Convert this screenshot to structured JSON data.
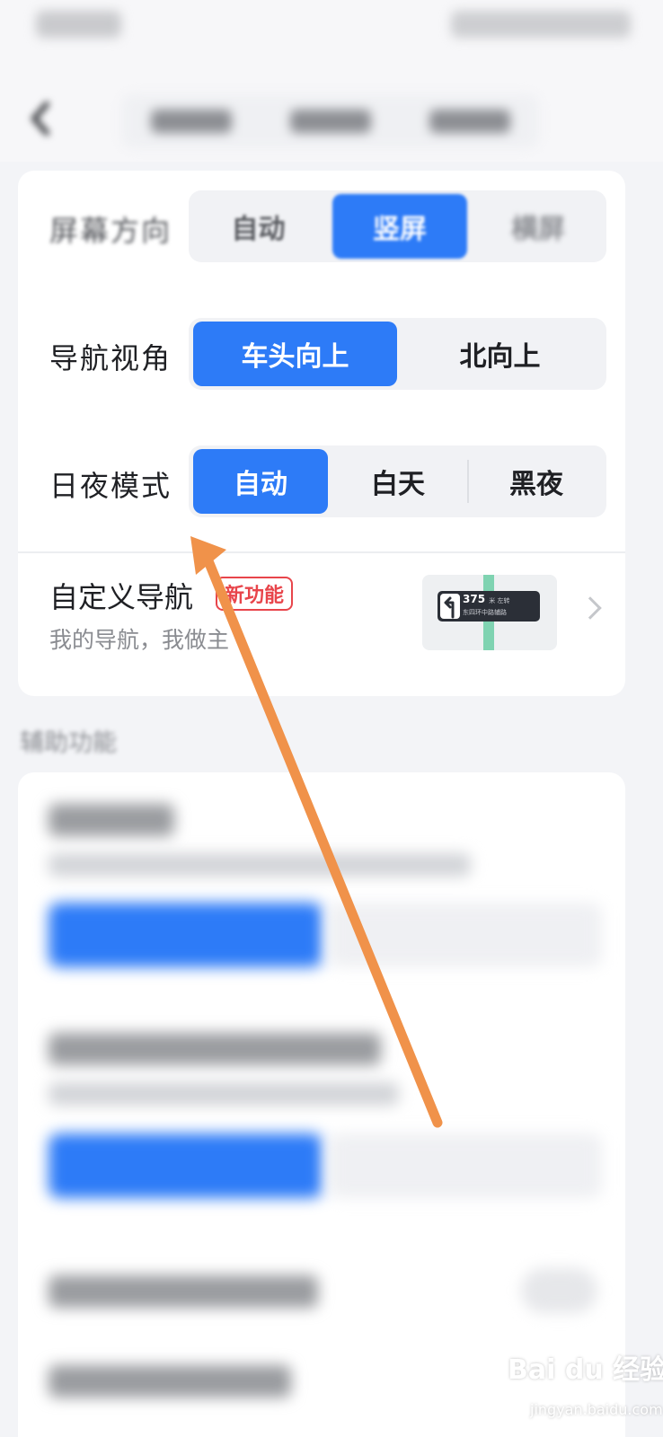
{
  "settings": {
    "screen_orientation": {
      "label": "屏幕方向",
      "options": [
        "自动",
        "竖屏",
        "横屏"
      ],
      "selected": "竖屏"
    },
    "nav_view": {
      "label": "导航视角",
      "options": [
        "车头向上",
        "北向上"
      ],
      "selected": "车头向上"
    },
    "day_night": {
      "label": "日夜模式",
      "options": [
        "自动",
        "白天",
        "黑夜"
      ],
      "selected": "自动"
    },
    "custom_nav": {
      "title": "自定义导航",
      "badge": "新功能",
      "subtitle": "我的导航，我做主",
      "preview_distance": "375",
      "preview_unit": "米 左转",
      "preview_road": "东四环中路辅路"
    }
  },
  "section": {
    "title": "辅助功能"
  },
  "watermark": {
    "main": "Bai du 经验",
    "sub": "jingyan.baidu.com"
  },
  "colors": {
    "accent": "#2d7bf7",
    "badge": "#e8454b",
    "annotation_arrow": "#f0924a"
  }
}
